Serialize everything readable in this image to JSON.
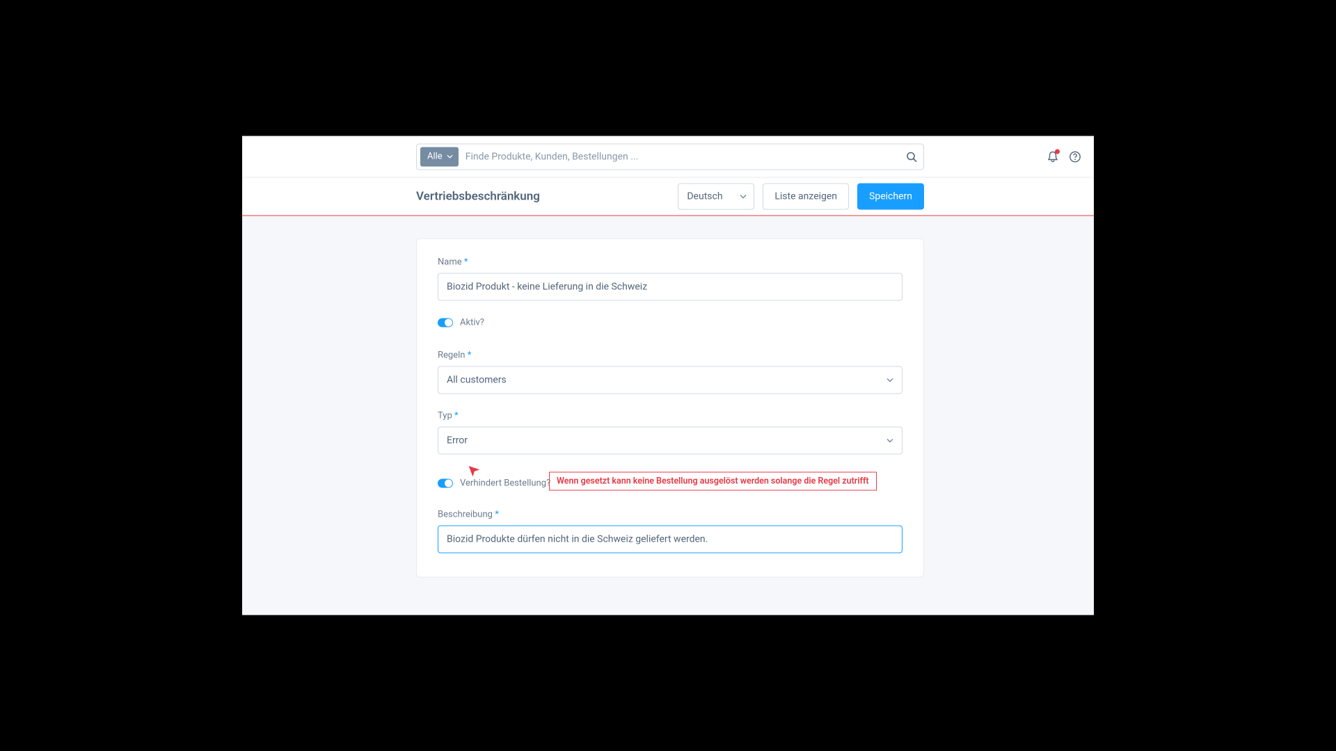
{
  "search": {
    "filter_label": "Alle",
    "placeholder": "Finde Produkte, Kunden, Bestellungen ..."
  },
  "page": {
    "title": "Vertriebsbeschränkung"
  },
  "actions": {
    "language_selected": "Deutsch",
    "list_button": "Liste anzeigen",
    "save_button": "Speichern"
  },
  "form": {
    "name_label": "Name",
    "name_value": "Biozid Produkt - keine Lieferung in die Schweiz",
    "active_label": "Aktiv?",
    "active_value": true,
    "rules_label": "Regeln",
    "rules_value": "All customers",
    "type_label": "Typ",
    "type_value": "Error",
    "prevents_order_label": "Verhindert Bestellung?",
    "prevents_order_value": true,
    "description_label": "Beschreibung",
    "description_value": "Biozid Produkte dürfen nicht in die Schweiz geliefert werden."
  },
  "annotation": {
    "text": "Wenn gesetzt kann keine Bestellung ausgelöst werden solange die Regel zutrifft"
  }
}
